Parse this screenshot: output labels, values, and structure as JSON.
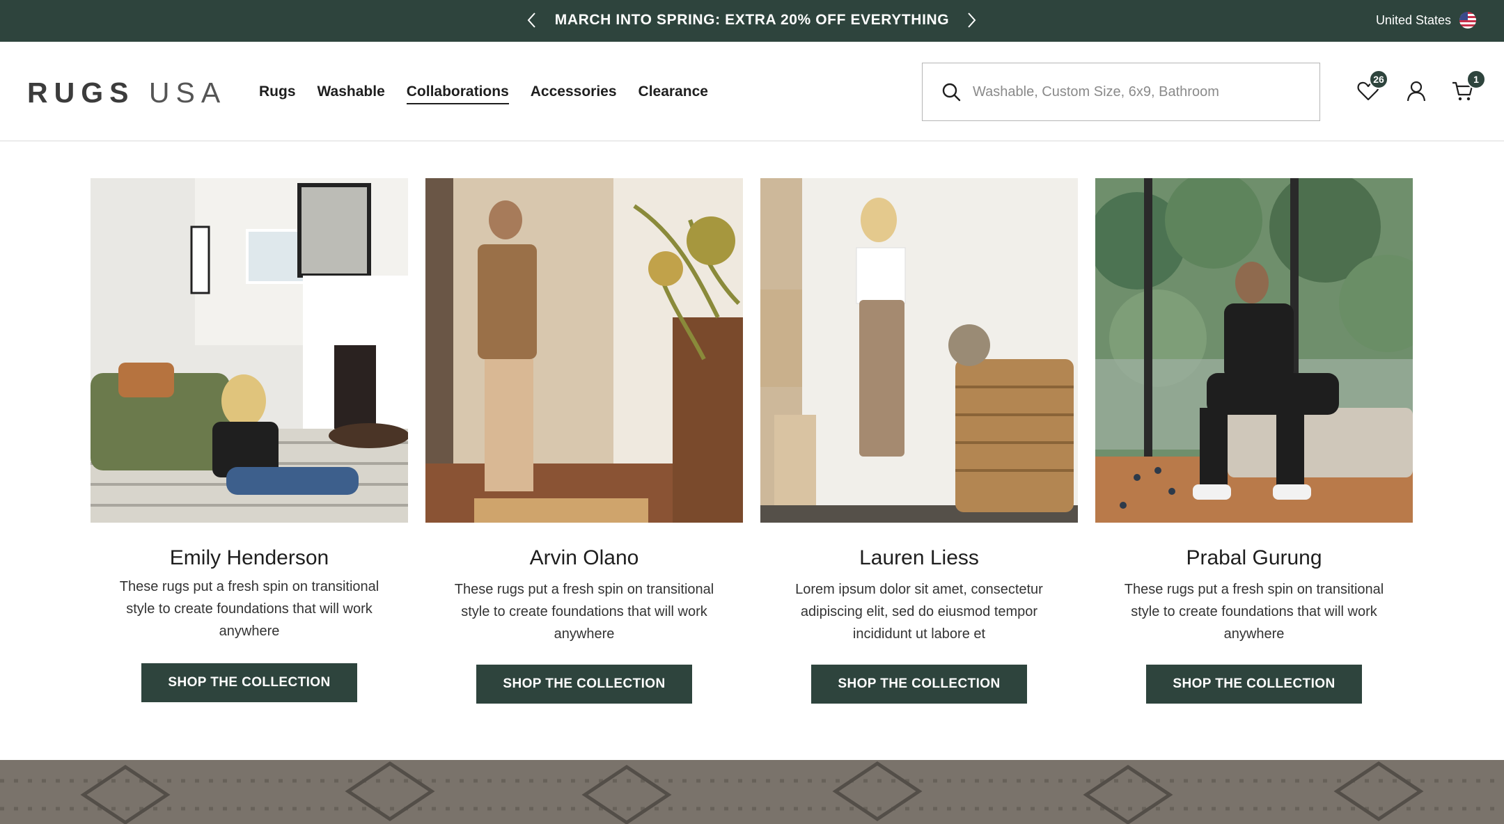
{
  "announcement": {
    "message": "MARCH INTO SPRING: EXTRA 20% OFF EVERYTHING",
    "region": "United States"
  },
  "header": {
    "logo": {
      "bold": "RUGS",
      "light": "USA"
    },
    "nav": [
      "Rugs",
      "Washable",
      "Collaborations",
      "Accessories",
      "Clearance"
    ],
    "active_nav": "Collaborations",
    "search_placeholder": "Washable, Custom Size, 6x9, Bathroom",
    "wishlist_count": "26",
    "cart_count": "1"
  },
  "collaborations": [
    {
      "name": "Emily Henderson",
      "description": "These rugs put a fresh spin on transitional style to create foundations that will work anywhere",
      "button": "SHOP THE COLLECTION"
    },
    {
      "name": "Arvin Olano",
      "description": "These rugs put a fresh spin on transitional style to create foundations that will work anywhere",
      "button": "SHOP THE COLLECTION"
    },
    {
      "name": "Lauren Liess",
      "description": "Lorem ipsum dolor sit amet, consectetur adipiscing elit, sed do eiusmod tempor incididunt ut labore et",
      "button": "SHOP THE COLLECTION"
    },
    {
      "name": "Prabal Gurung",
      "description": "These rugs put a fresh spin on transitional style to create foundations that will work anywhere",
      "button": "SHOP THE COLLECTION"
    }
  ],
  "colors": {
    "brand_dark_green": "#2e443d",
    "text": "#1e1e1e"
  }
}
